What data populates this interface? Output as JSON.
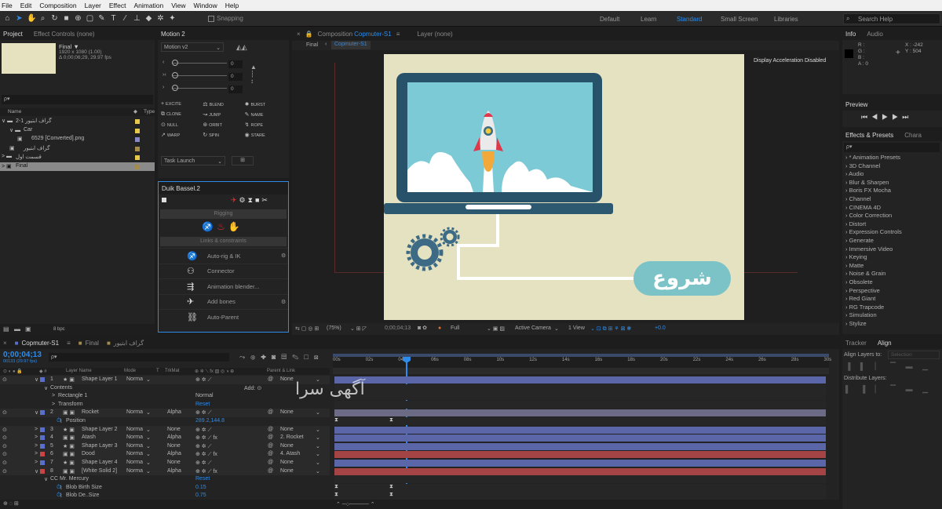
{
  "menu": [
    "File",
    "Edit",
    "Composition",
    "Layer",
    "Effect",
    "Animation",
    "View",
    "Window",
    "Help"
  ],
  "toolbar": {
    "snapping": "Snapping",
    "workspaces": [
      "Default",
      "Learn",
      "Standard",
      "Small Screen",
      "Libraries"
    ],
    "search_placeholder": "Search Help"
  },
  "project": {
    "tab": "Project",
    "effect_controls_tab": "Effect Controls (none)",
    "comp_name": "Final ▼",
    "comp_info1": "1920 x 1080 (1.00)",
    "comp_info2": "Δ 0;00;06;29, 29.97 fps",
    "search_glyph": "ρ▾",
    "col_name": "Name",
    "col_type": "Type",
    "items": [
      "گراف ابتیور 1-2",
      "Car",
      "6529 [Converted].png",
      "گراف ابتیور",
      "قسمت اول",
      "Final"
    ],
    "bpc": "8 bpc"
  },
  "motion": {
    "tab": "Motion 2",
    "preset": "Motion v2",
    "value": "0",
    "buttons": [
      "EXCITE",
      "BLEND",
      "BURST",
      "CLONE",
      "JUMP",
      "NAME",
      "NULL",
      "ORBIT",
      "ROPE",
      "WARP",
      "SPIN",
      "STARE"
    ],
    "task": "Task Launch"
  },
  "duik": {
    "tab": "Duik Bassel.2",
    "rigging": "Rigging",
    "links": "Links & constraints",
    "items": [
      "Auto-rig & IK",
      "Connector",
      "Animation blender...",
      "Add bones",
      "Auto-Parent"
    ]
  },
  "comp": {
    "lock": "🔒",
    "tab_prefix": "Composition",
    "tab_name": "Copmuter-S1",
    "layer_tab": "Layer (none)",
    "bc1": "Final",
    "bc2": "Copmuter-S1",
    "accel": "Display Acceleration Disabled",
    "start_label": "شروع",
    "watermark": "آگهی سرا",
    "zoom": "(75%)",
    "time": "0;00;04;13",
    "res": "Full",
    "camera": "Active Camera",
    "views": "1 View",
    "exposure": "+0.0"
  },
  "info": {
    "tab": "Info",
    "audio_tab": "Audio",
    "r": "R :",
    "g": "G :",
    "b": "B :",
    "a": "A : 0",
    "x": "X : -242",
    "y": "Y : 504"
  },
  "preview": {
    "tab": "Preview"
  },
  "effects": {
    "tab": "Effects & Presets",
    "char_tab": "Chara",
    "search_glyph": "ρ▾",
    "items": [
      "* Animation Presets",
      "3D Channel",
      "Audio",
      "Blur & Sharpen",
      "Boris FX Mocha",
      "Channel",
      "CINEMA 4D",
      "Color Correction",
      "Distort",
      "Expression Controls",
      "Generate",
      "Immersive Video",
      "Keying",
      "Matte",
      "Noise & Grain",
      "Obsolete",
      "Perspective",
      "Red Giant",
      "RG Trapcode",
      "Simulation",
      "Stylize"
    ]
  },
  "align": {
    "tracker": "Tracker",
    "tab": "Align",
    "layers_to": "Align Layers to:",
    "selection": "Selection",
    "distribute": "Distribute Layers:"
  },
  "timeline": {
    "tabs": [
      "Copmuter-S1",
      "Final",
      "گراف ابتیور"
    ],
    "time": "0;00;04;13",
    "frames": "00133 (29.97 fps)",
    "search_glyph": "ρ▾",
    "cols": {
      "layer": "Layer Name",
      "mode": "Mode",
      "t": "T",
      "trkmat": "TrkMat",
      "parent": "Parent & Link"
    },
    "ruler": [
      "00s",
      "02s",
      "04s",
      "06s",
      "08s",
      "10s",
      "12s",
      "14s",
      "16s",
      "18s",
      "20s",
      "22s",
      "24s",
      "26s",
      "28s",
      "30s"
    ],
    "rows": [
      {
        "num": "1",
        "name": "Shape Layer 1",
        "mode": "Norma",
        "trk": "",
        "parent": "None",
        "color": "#5a6fc9",
        "bar": "#5a66a8",
        "tri": "∨",
        "star": "★",
        "fx": ""
      },
      {
        "num": "",
        "name": "Contents",
        "sub": 1,
        "extra": "Add: ⊙"
      },
      {
        "num": "",
        "name": "Rectangle 1",
        "sub": 2,
        "extra": "Normal"
      },
      {
        "num": "",
        "name": "Transform",
        "sub": 2,
        "extra": "Reset"
      },
      {
        "num": "2",
        "name": "Rocket",
        "mode": "Norma",
        "trk": "Alpha",
        "parent": "None",
        "color": "#5a6fc9",
        "bar": "#6b6b86",
        "tri": "∨",
        "star": "",
        "fx": ""
      },
      {
        "num": "",
        "name": "Position",
        "sub": 3,
        "extra": "289.2,144.8"
      },
      {
        "num": "3",
        "name": "Shape Layer 2",
        "mode": "Norma",
        "trk": "None",
        "parent": "None",
        "color": "#5a6fc9",
        "bar": "#5a66a8",
        "tri": ">",
        "star": "★",
        "fx": ""
      },
      {
        "num": "4",
        "name": "Atash",
        "mode": "Norma",
        "trk": "Alpha",
        "parent": "2. Rocket",
        "color": "#5a6fc9",
        "bar": "#5a66a8",
        "tri": ">",
        "star": "",
        "fx": "fx"
      },
      {
        "num": "5",
        "name": "Shape Layer 3",
        "mode": "Norma",
        "trk": "None",
        "parent": "None",
        "color": "#5a6fc9",
        "bar": "#5a66a8",
        "tri": ">",
        "star": "★",
        "fx": ""
      },
      {
        "num": "6",
        "name": "Dood",
        "mode": "Norma",
        "trk": "Alpha",
        "parent": "4. Atash",
        "color": "#c94444",
        "bar": "#a54444",
        "tri": ">",
        "star": "",
        "fx": "fx"
      },
      {
        "num": "7",
        "name": "Shape Layer 4",
        "mode": "Norma",
        "trk": "None",
        "parent": "None",
        "color": "#5a6fc9",
        "bar": "#5a66a8",
        "tri": ">",
        "star": "★",
        "fx": ""
      },
      {
        "num": "8",
        "name": "[White Solid 2]",
        "mode": "Norma",
        "trk": "Alpha",
        "parent": "None",
        "color": "#c94444",
        "bar": "#a54444",
        "tri": "∨",
        "star": "",
        "fx": "fx"
      },
      {
        "num": "",
        "name": "CC Mr. Mercury",
        "sub": 1,
        "extra": "Reset"
      },
      {
        "num": "",
        "name": "Blob Birth Size",
        "sub": 3,
        "extra": "0.15"
      },
      {
        "num": "",
        "name": "Blob De..Size",
        "sub": 3,
        "extra": "0.75"
      }
    ]
  }
}
